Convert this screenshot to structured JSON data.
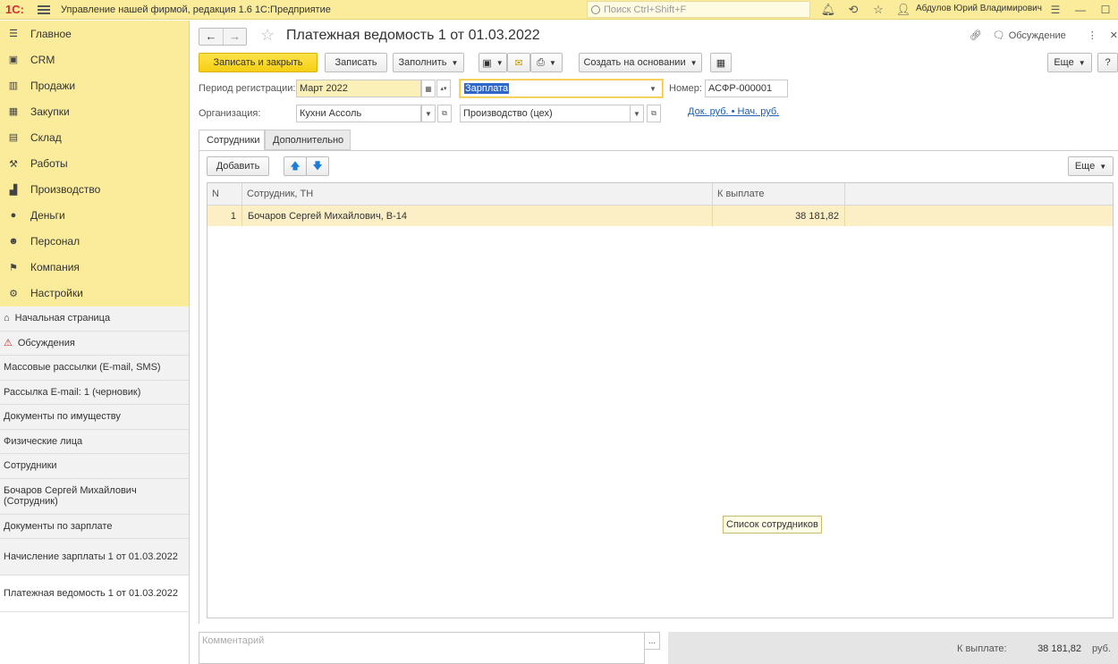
{
  "topbar": {
    "logo": "1С:",
    "title": "Управление нашей фирмой, редакция 1.6 1С:Предприятие",
    "search_placeholder": "Поиск Ctrl+Shift+F",
    "user": "Абдулов Юрий Владимирович"
  },
  "sections": [
    {
      "label": "Главное",
      "icon": "menu-icon"
    },
    {
      "label": "CRM",
      "icon": "crm-icon"
    },
    {
      "label": "Продажи",
      "icon": "basket-icon"
    },
    {
      "label": "Закупки",
      "icon": "cart-icon"
    },
    {
      "label": "Склад",
      "icon": "warehouse-icon"
    },
    {
      "label": "Работы",
      "icon": "tools-icon"
    },
    {
      "label": "Производство",
      "icon": "factory-icon"
    },
    {
      "label": "Деньги",
      "icon": "money-icon"
    },
    {
      "label": "Персонал",
      "icon": "people-icon"
    },
    {
      "label": "Компания",
      "icon": "flag-icon"
    },
    {
      "label": "Настройки",
      "icon": "gear-icon"
    }
  ],
  "history": [
    {
      "label": "Начальная страница",
      "icon": "home-icon"
    },
    {
      "label": "Обсуждения",
      "icon": "warning-icon"
    },
    {
      "label": "Массовые рассылки (E-mail, SMS)"
    },
    {
      "label": "Рассылка E-mail: 1  (черновик)"
    },
    {
      "label": "Документы по имуществу"
    },
    {
      "label": "Физические лица"
    },
    {
      "label": "Сотрудники"
    },
    {
      "label": "Бочаров Сергей Михайлович (Сотрудник)"
    },
    {
      "label": "Документы по зарплате"
    },
    {
      "label": "Начисление зарплаты 1 от 01.03.2022"
    },
    {
      "label": "Платежная ведомость 1 от 01.03.2022"
    }
  ],
  "doc": {
    "title": "Платежная ведомость 1 от 01.03.2022",
    "discussion": "Обсуждение"
  },
  "toolbar": {
    "save_close": "Записать и закрыть",
    "save": "Записать",
    "fill": "Заполнить",
    "create_based": "Создать на основании",
    "more": "Еще"
  },
  "form": {
    "period_label": "Период регистрации:",
    "period_value": "Март 2022",
    "type_value": "Зарплата",
    "number_label": "Номер:",
    "number_value": "АСФР-000001",
    "org_label": "Организация:",
    "org_value": "Кухни Ассоль",
    "dept_value": "Производство (цех)",
    "currency_link": "Док. руб. • Нач. руб."
  },
  "tabs": [
    "Сотрудники",
    "Дополнительно"
  ],
  "table_toolbar": {
    "add": "Добавить",
    "more": "Еще"
  },
  "table": {
    "columns": [
      "N",
      "Сотрудник, ТН",
      "К выплате"
    ],
    "rows": [
      {
        "n": "1",
        "employee": "Бочаров Сергей Михайлович, В-14",
        "amount": "38 181,82"
      }
    ]
  },
  "tooltip": "Список сотрудников",
  "footer": {
    "comment_placeholder": "Комментарий",
    "total_label": "К выплате:",
    "total_value": "38 181,82",
    "currency": "руб."
  }
}
